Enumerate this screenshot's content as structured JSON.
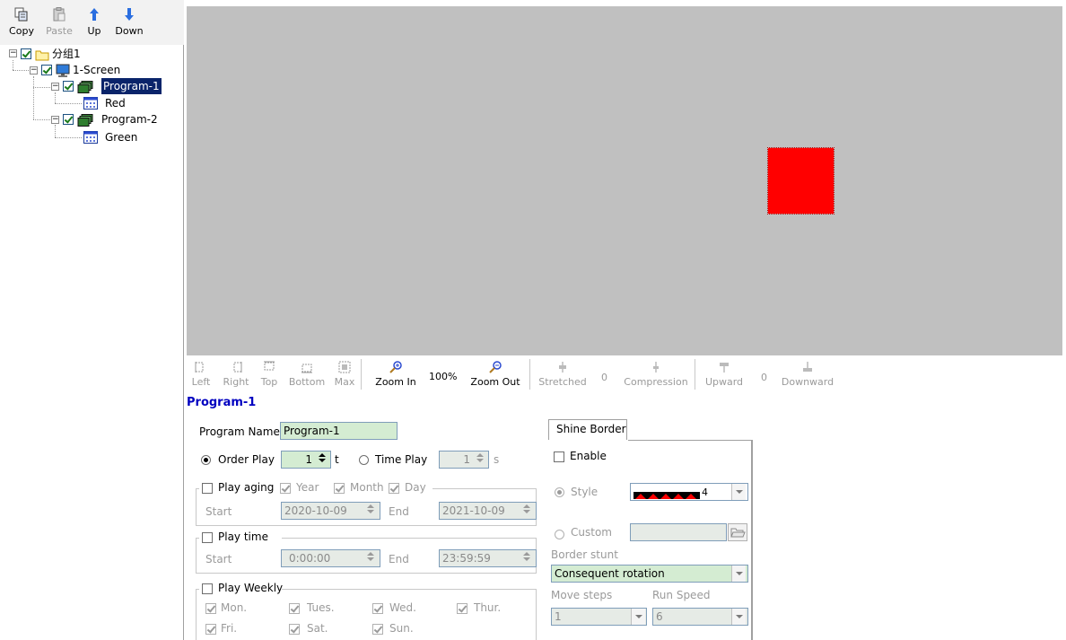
{
  "toolbar": {
    "copy": "Copy",
    "paste": "Paste",
    "up": "Up",
    "down": "Down"
  },
  "tree": {
    "group": "分组1",
    "screen": "1-Screen",
    "program1": "Program-1",
    "red": "Red",
    "program2": "Program-2",
    "green": "Green",
    "expander": "−"
  },
  "canvas": {
    "background": "#c0c0c0",
    "area_color": "#ff0000"
  },
  "zoom_toolbar": {
    "left": "Left",
    "right": "Right",
    "top": "Top",
    "bottom": "Bottom",
    "max": "Max",
    "zoom_in": "Zoom In",
    "zoom_level": "100%",
    "zoom_out": "Zoom Out",
    "stretched": "Stretched",
    "stretched_value": "0",
    "compression": "Compression",
    "upward": "Upward",
    "upward_value": "0",
    "downward": "Downward"
  },
  "props": {
    "title": "Program-1",
    "program_name_label": "Program Name",
    "program_name_value": "Program-1",
    "order_play": "Order Play",
    "order_play_value": "1",
    "order_unit": "t",
    "time_play": "Time Play",
    "time_play_value": "1",
    "time_unit": "s",
    "play_aging": "Play aging",
    "year": "Year",
    "month": "Month",
    "day": "Day",
    "start": "Start",
    "end": "End",
    "aging_start": "2020-10-09",
    "aging_end": "2021-10-09",
    "play_time": "Play time",
    "time_start": "0:00:00",
    "time_end": "23:59:59",
    "play_weekly": "Play Weekly",
    "days": [
      "Mon.",
      "Tues.",
      "Wed.",
      "Thur.",
      "Fri.",
      "Sat.",
      "Sun."
    ]
  },
  "shine": {
    "tab": "Shine Border",
    "enable": "Enable",
    "style": "Style",
    "style_value": "4",
    "custom": "Custom",
    "border_stunt": "Border stunt",
    "border_stunt_value": "Consequent rotation",
    "move_steps": "Move steps",
    "move_steps_value": "1",
    "run_speed": "Run Speed",
    "run_speed_value": "6"
  }
}
